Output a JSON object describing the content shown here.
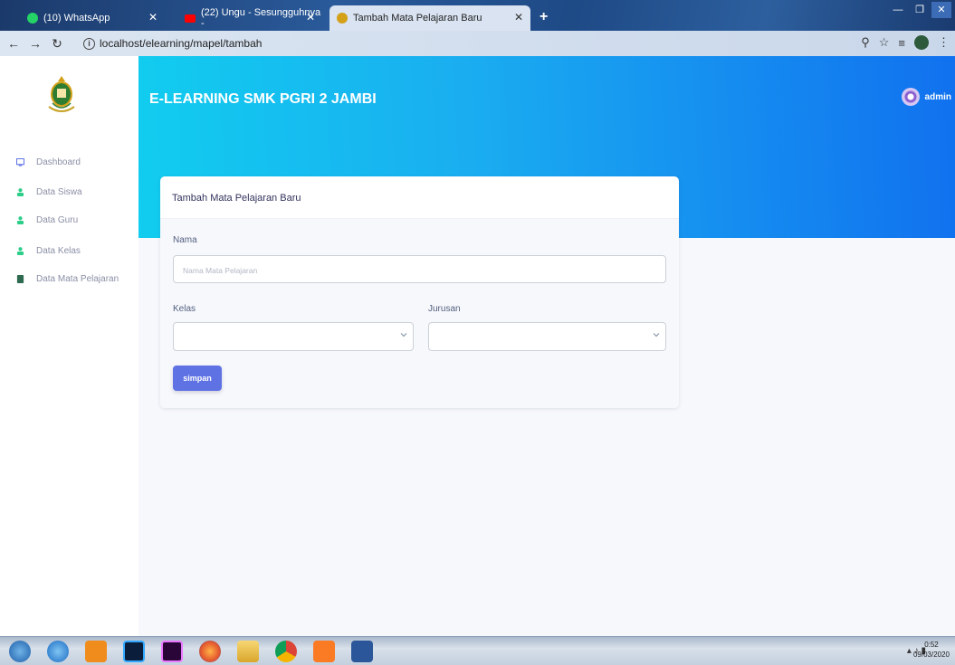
{
  "browser": {
    "tabs": [
      {
        "label": "(10) WhatsApp",
        "favicon_color": "#25d366"
      },
      {
        "label": "(22) Ungu - Sesungguhnya -",
        "favicon_color": "#ff0000"
      },
      {
        "label": "Tambah Mata Pelajaran Baru",
        "favicon_color": "#d4a017"
      }
    ],
    "url": "localhost/elearning/mapel/tambah",
    "new_tab_label": "+"
  },
  "app": {
    "brand": "E-LEARNING SMK PGRI 2 JAMBI",
    "user_name": "admin",
    "sidebar": {
      "items": [
        {
          "label": "Dashboard",
          "icon": "monitor-icon",
          "color": "#5e72e4"
        },
        {
          "label": "Data Siswa",
          "icon": "user-icon",
          "color": "#2dce89"
        },
        {
          "label": "Data Guru",
          "icon": "user-icon",
          "color": "#2dce89"
        },
        {
          "label": "Data Kelas",
          "icon": "user-icon",
          "color": "#2dce89"
        },
        {
          "label": "Data Mata Pelajaran",
          "icon": "book-icon",
          "color": "#2d6a4f"
        }
      ]
    },
    "form": {
      "title": "Tambah Mata Pelajaran Baru",
      "nama_label": "Nama",
      "nama_placeholder": "Nama Mata Pelajaran",
      "kelas_label": "Kelas",
      "kelas_value": "",
      "jurusan_label": "Jurusan",
      "jurusan_value": "",
      "submit_label": "simpan"
    },
    "colors": {
      "header_gradient_start": "#11cdef",
      "header_gradient_end": "#1171ef",
      "primary_button": "#5e72e4"
    }
  },
  "taskbar": {
    "clock_time": "0:52",
    "clock_date": "09/03/2020",
    "apps": [
      "start-orb",
      "internet-explorer",
      "media-player",
      "photoshop",
      "premiere",
      "firefox",
      "file-explorer",
      "chrome",
      "xampp",
      "word"
    ]
  }
}
